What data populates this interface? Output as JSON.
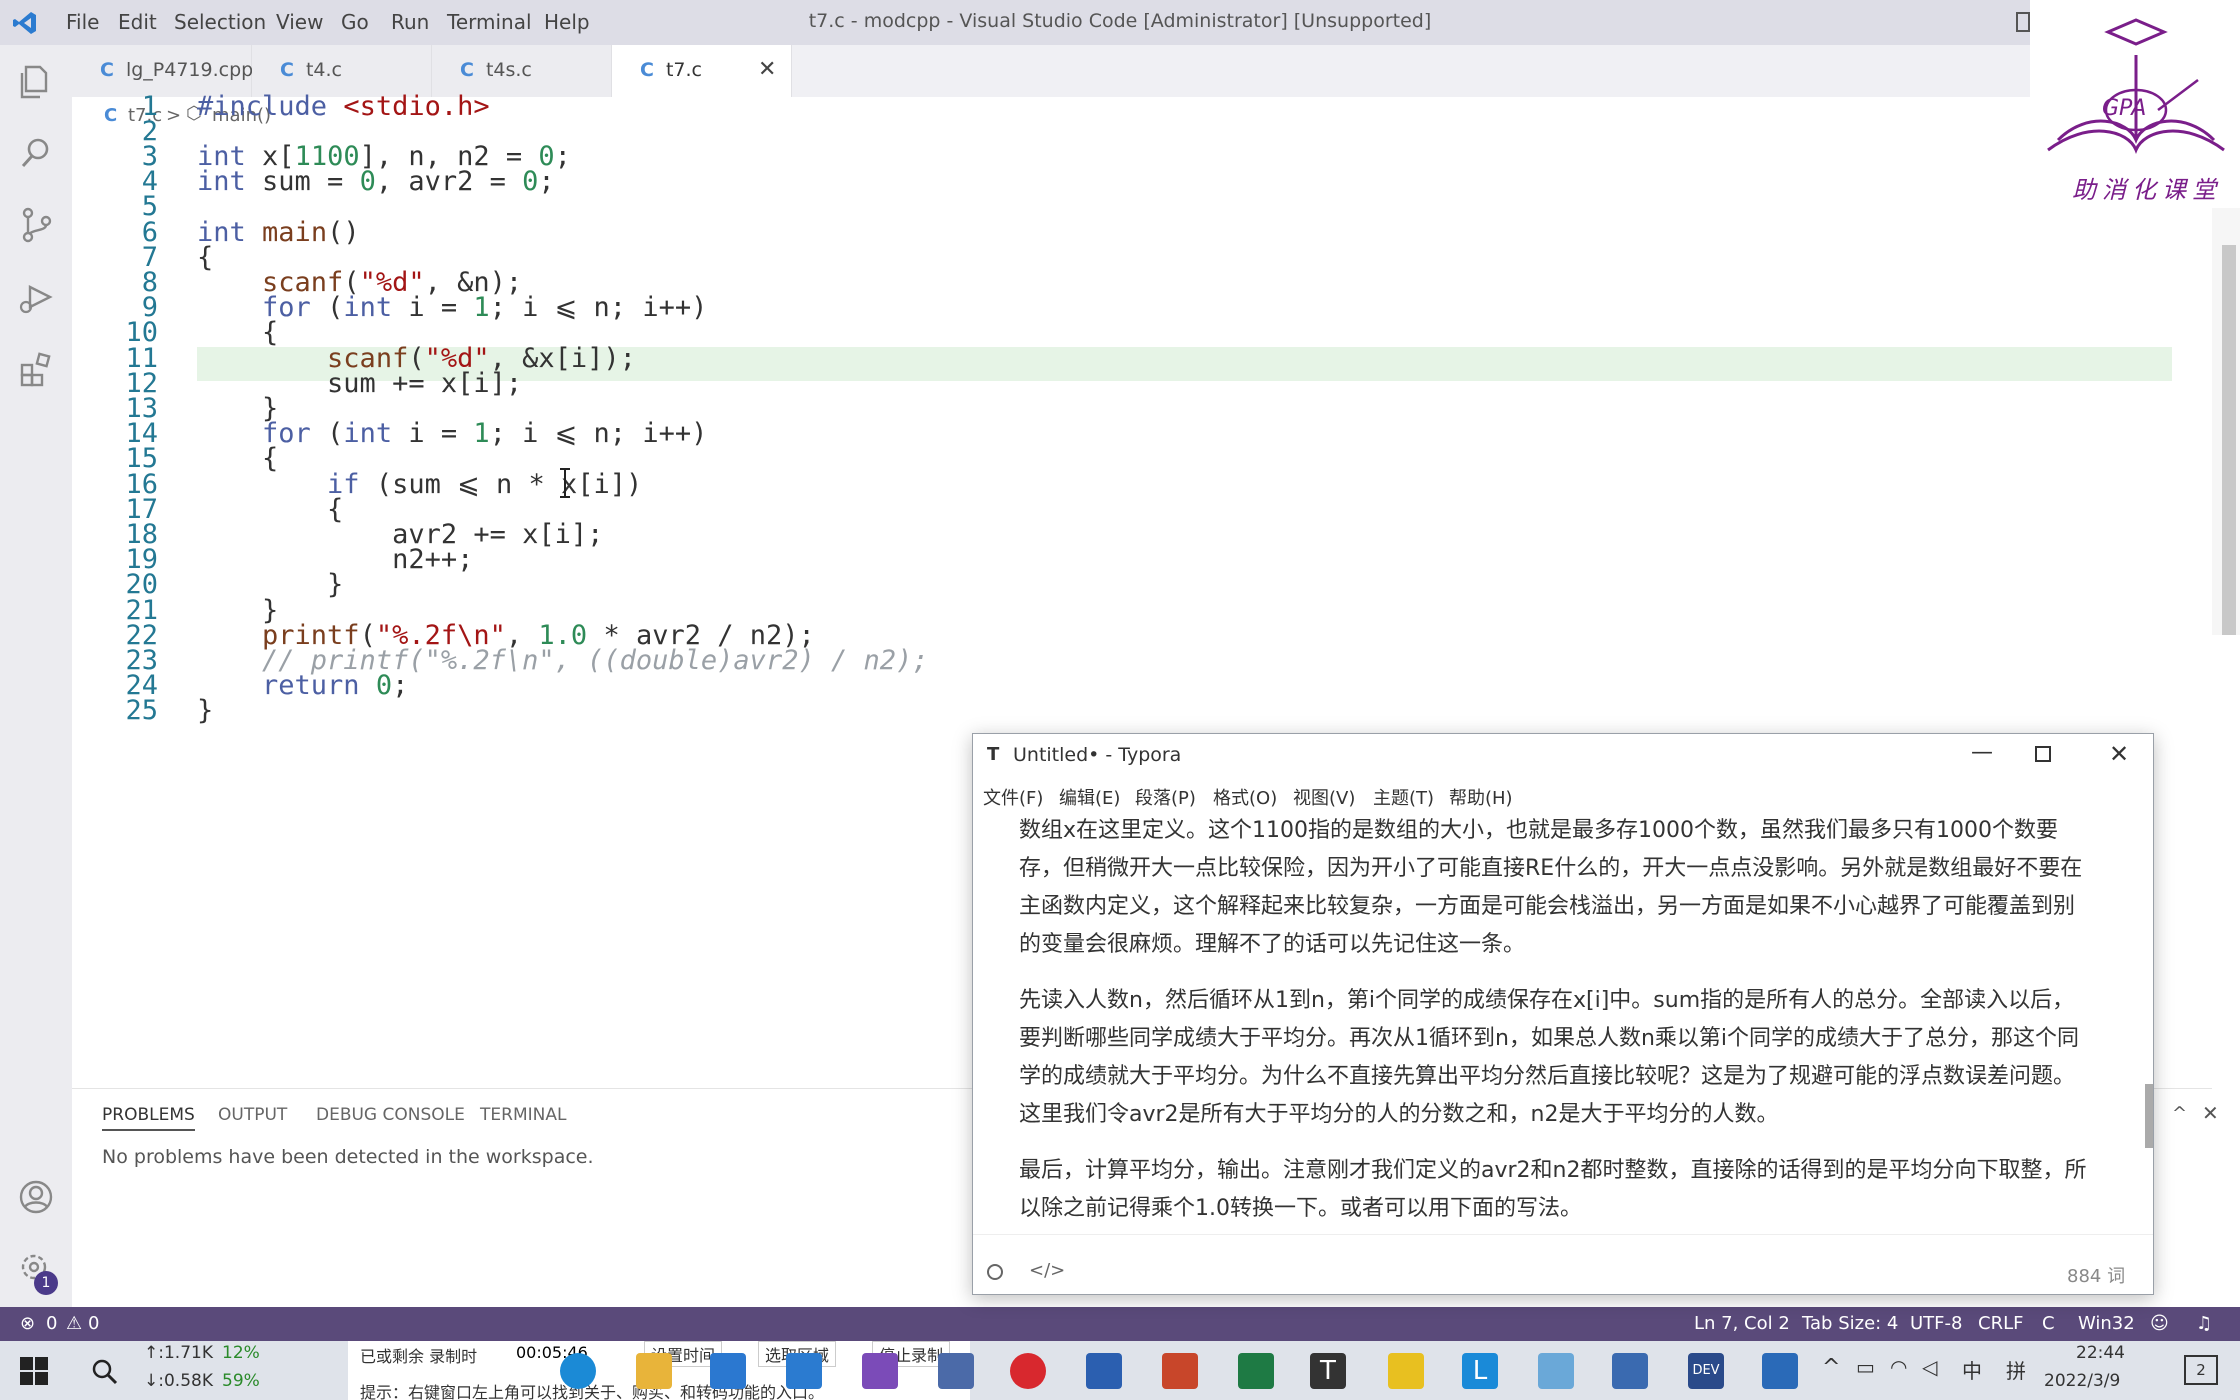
{
  "window": {
    "title": "t7.c - modcpp - Visual Studio Code [Administrator] [Unsupported]",
    "menu": [
      "File",
      "Edit",
      "Selection",
      "View",
      "Go",
      "Run",
      "Terminal",
      "Help"
    ]
  },
  "tabs": [
    {
      "label": "lg_P4719.cpp",
      "icon": "cpp-file-icon"
    },
    {
      "label": "t4.c",
      "icon": "c-file-icon"
    },
    {
      "label": "t4s.c",
      "icon": "c-file-icon"
    },
    {
      "label": "t7.c",
      "icon": "c-file-icon",
      "active": true
    }
  ],
  "breadcrumb": {
    "file": "t7.c",
    "separator": ">",
    "symbol": "main()"
  },
  "code_lines": [
    "#include <stdio.h>",
    "",
    "int x[1100], n, n2 = 0;",
    "int sum = 0, avr2 = 0;",
    "",
    "int main()",
    "{",
    "    scanf(\"%d\", &n);",
    "    for (int i = 1; i ⩽ n; i++)",
    "    {",
    "        scanf(\"%d\", &x[i]);",
    "        sum += x[i];",
    "    }",
    "    for (int i = 1; i ⩽ n; i++)",
    "    {",
    "        if (sum ⩽ n * x[i])",
    "        {",
    "            avr2 += x[i];",
    "            n2++;",
    "        }",
    "    }",
    "    printf(\"%.2f\\n\", 1.0 * avr2 / n2);",
    "    // printf(\"%.2f\\n\", ((double)avr2) / n2);",
    "    return 0;",
    "}"
  ],
  "line_numbers": [
    "1",
    "2",
    "3",
    "4",
    "5",
    "6",
    "7",
    "8",
    "9",
    "10",
    "11",
    "12",
    "13",
    "14",
    "15",
    "16",
    "17",
    "18",
    "19",
    "20",
    "21",
    "22",
    "23",
    "24",
    "25"
  ],
  "panel": {
    "tabs": [
      "PROBLEMS",
      "OUTPUT",
      "DEBUG CONSOLE",
      "TERMINAL"
    ],
    "active_tab": "PROBLEMS",
    "message": "No problems have been detected in the workspace."
  },
  "statusbar": {
    "errors": "0",
    "warnings": "0",
    "position": "Ln 7, Col 2",
    "tab_size": "Tab Size: 4",
    "encoding": "UTF-8",
    "eol": "CRLF",
    "language": "C",
    "platform": "Win32"
  },
  "typora": {
    "title": "Untitled• - Typora",
    "menu": [
      "文件(F)",
      "编辑(E)",
      "段落(P)",
      "格式(O)",
      "视图(V)",
      "主题(T)",
      "帮助(H)"
    ],
    "paragraphs": [
      "数组x在这里定义。这个1100指的是数组的大小，也就是最多存1000个数，虽然我们最多只有1000个数要存，但稍微开大一点比较保险，因为开小了可能直接RE什么的，开大一点点没影响。另外就是数组最好不要在主函数内定义，这个解释起来比较复杂，一方面是可能会栈溢出，另一方面是如果不小心越界了可能覆盖到别的变量会很麻烦。理解不了的话可以先记住这一条。",
      "先读入人数n，然后循环从1到n，第i个同学的成绩保存在x[i]中。sum指的是所有人的总分。全部读入以后，要判断哪些同学成绩大于平均分。再次从1循环到n，如果总人数n乘以第i个同学的成绩大于了总分，那这个同学的成绩就大于平均分。为什么不直接先算出平均分然后直接比较呢？这是为了规避可能的浮点数误差问题。这里我们令avr2是所有大于平均分的人的分数之和，n2是大于平均分的人数。",
      "最后，计算平均分，输出。注意刚才我们定义的avr2和n2都时整数，直接除的话得到的是平均分向下取整，所以除之前记得乘个1.0转换一下。或者可以用下面的写法。"
    ],
    "word_count": "884 词"
  },
  "logo": {
    "text": "GPA",
    "subtitle": "助消化课堂"
  },
  "taskbar": {
    "net_up": "↑:1.71K",
    "net_down": "↓:0.58K",
    "cpu": "12%",
    "mem": "59%",
    "recorder_label": "已或剩余 录制时",
    "recorder_time": "00:05:46",
    "recorder_btn1": "设置时间",
    "recorder_btn2": "选取区域",
    "recorder_btn3": "停止录制",
    "recorder_tip": "提示：右键窗口左上角可以找到关于、购买、和转码功能的入口。",
    "ime1": "中",
    "ime2": "拼",
    "time": "22:44",
    "date": "2022/3/9",
    "notify": "2"
  }
}
